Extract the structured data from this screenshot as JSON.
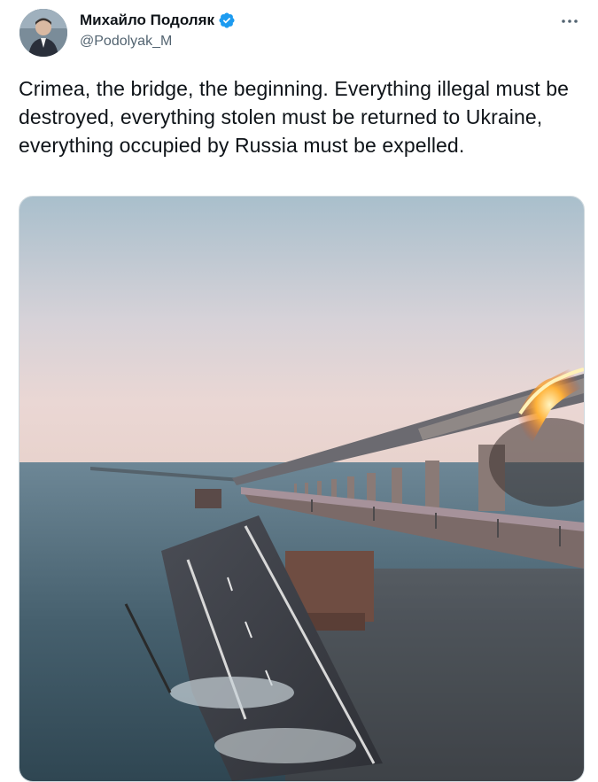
{
  "author": {
    "display_name": "Михайло Подоляк",
    "handle": "@Podolyak_M",
    "verified": true,
    "avatar_icon": "avatar",
    "verified_icon": "verified-badge-icon",
    "verified_color": "#1d9bf0"
  },
  "menu": {
    "more_icon": "more-options-icon",
    "more_label": "···"
  },
  "tweet": {
    "text": "Crimea, the bridge, the beginning. Everything illegal must be destroyed, everything stolen must be returned to Ukraine, everything occupied by Russia must be expelled."
  },
  "media": {
    "type": "photo",
    "subject": "collapsed bridge span over the sea with fire on the railway bridge"
  },
  "colors": {
    "text_primary": "#0f1419",
    "text_secondary": "#536471",
    "border": "#cfd9de"
  }
}
